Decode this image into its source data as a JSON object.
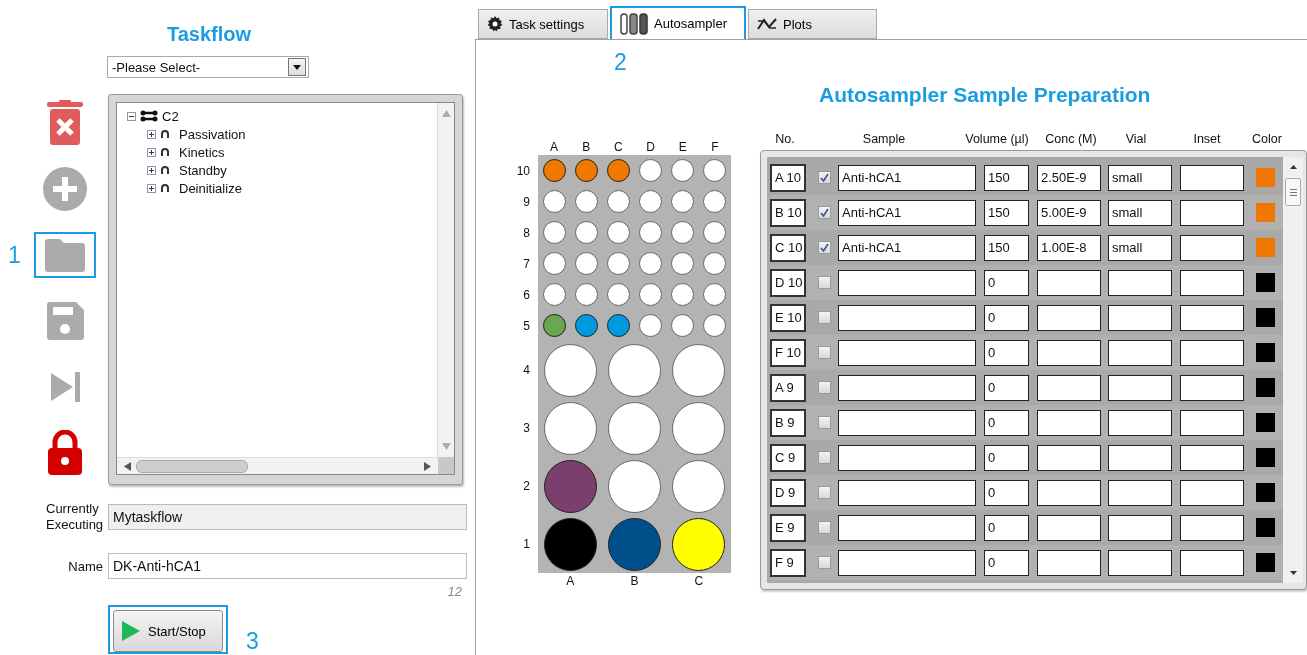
{
  "taskflow": {
    "title": "Taskflow",
    "select": {
      "value": "-Please Select-"
    },
    "tools": [
      {
        "kind": "delete"
      },
      {
        "kind": "add"
      },
      {
        "kind": "open",
        "callout": "1"
      },
      {
        "kind": "save"
      },
      {
        "kind": "skip"
      },
      {
        "kind": "lock"
      }
    ],
    "tree": {
      "label": "C2",
      "expanded": true,
      "children": [
        {
          "label": "Passivation",
          "expanded": false
        },
        {
          "label": "Kinetics",
          "expanded": false
        },
        {
          "label": "Standby",
          "expanded": false
        },
        {
          "label": "Deinitialize",
          "expanded": false
        }
      ]
    },
    "currently_executing": {
      "label": "Currently Executing",
      "value": "Mytaskflow"
    },
    "name": {
      "label": "Name",
      "value": "DK-Anti-hCA1",
      "counter": "12"
    },
    "start_button": {
      "label": "Start/Stop",
      "callout": "3"
    }
  },
  "tabs": [
    {
      "label": "Task settings",
      "kind": "settings",
      "selected": false
    },
    {
      "label": "Autosampler",
      "kind": "autosampler",
      "selected": true,
      "callout": "2"
    },
    {
      "label": "Plots",
      "kind": "plots",
      "selected": false
    }
  ],
  "autosampler": {
    "title": "Autosampler Sample Preparation",
    "plate": {
      "top_columns": [
        "A",
        "B",
        "C",
        "D",
        "E",
        "F"
      ],
      "small_rows": [
        {
          "label": "10",
          "wells": [
            {
              "color": "#f07800"
            },
            {
              "color": "#f07800"
            },
            {
              "color": "#f07800"
            },
            {
              "color": "#ffffff"
            },
            {
              "color": "#ffffff"
            },
            {
              "color": "#ffffff"
            }
          ]
        },
        {
          "label": "9",
          "wells": [
            {
              "color": "#ffffff"
            },
            {
              "color": "#ffffff"
            },
            {
              "color": "#ffffff"
            },
            {
              "color": "#ffffff"
            },
            {
              "color": "#ffffff"
            },
            {
              "color": "#ffffff"
            }
          ]
        },
        {
          "label": "8",
          "wells": [
            {
              "color": "#ffffff"
            },
            {
              "color": "#ffffff"
            },
            {
              "color": "#ffffff"
            },
            {
              "color": "#ffffff"
            },
            {
              "color": "#ffffff"
            },
            {
              "color": "#ffffff"
            }
          ]
        },
        {
          "label": "7",
          "wells": [
            {
              "color": "#ffffff"
            },
            {
              "color": "#ffffff"
            },
            {
              "color": "#ffffff"
            },
            {
              "color": "#ffffff"
            },
            {
              "color": "#ffffff"
            },
            {
              "color": "#ffffff"
            }
          ]
        },
        {
          "label": "6",
          "wells": [
            {
              "color": "#ffffff"
            },
            {
              "color": "#ffffff"
            },
            {
              "color": "#ffffff"
            },
            {
              "color": "#ffffff"
            },
            {
              "color": "#ffffff"
            },
            {
              "color": "#ffffff"
            }
          ]
        },
        {
          "label": "5",
          "wells": [
            {
              "color": "#6aa84f"
            },
            {
              "color": "#0099e0"
            },
            {
              "color": "#0099e0"
            },
            {
              "color": "#ffffff"
            },
            {
              "color": "#ffffff"
            },
            {
              "color": "#ffffff"
            }
          ]
        }
      ],
      "large_rows": [
        {
          "label": "4",
          "wells": [
            {
              "color": "#ffffff"
            },
            {
              "color": "#ffffff"
            },
            {
              "color": "#ffffff"
            }
          ]
        },
        {
          "label": "3",
          "wells": [
            {
              "color": "#ffffff"
            },
            {
              "color": "#ffffff"
            },
            {
              "color": "#ffffff"
            }
          ]
        },
        {
          "label": "2",
          "wells": [
            {
              "color": "#7b3f6e"
            },
            {
              "color": "#ffffff"
            },
            {
              "color": "#ffffff"
            }
          ]
        },
        {
          "label": "1",
          "wells": [
            {
              "color": "#000000"
            },
            {
              "color": "#004f8a"
            },
            {
              "color": "#ffff00"
            }
          ]
        }
      ],
      "bottom_columns": [
        "A",
        "B",
        "C"
      ]
    },
    "table": {
      "columns": [
        "No.",
        "Sample",
        "Volume (µl)",
        "Conc (M)",
        "Vial",
        "Inset",
        "Color"
      ],
      "rows": [
        {
          "no": "A 10",
          "checked": true,
          "sample": "Anti-hCA1",
          "volume": "150",
          "conc": "2.50E-9",
          "vial": "small",
          "color": "#f07800"
        },
        {
          "no": "B 10",
          "checked": true,
          "sample": "Anti-hCA1",
          "volume": "150",
          "conc": "5.00E-9",
          "vial": "small",
          "color": "#f07800"
        },
        {
          "no": "C 10",
          "checked": true,
          "sample": "Anti-hCA1",
          "volume": "150",
          "conc": "1.00E-8",
          "vial": "small",
          "color": "#f07800"
        },
        {
          "no": "D 10",
          "checked": false,
          "volume": "0",
          "color": "#000000"
        },
        {
          "no": "E 10",
          "checked": false,
          "volume": "0",
          "color": "#000000"
        },
        {
          "no": "F 10",
          "checked": false,
          "volume": "0",
          "color": "#000000"
        },
        {
          "no": "A 9",
          "checked": false,
          "volume": "0",
          "color": "#000000"
        },
        {
          "no": "B 9",
          "checked": false,
          "volume": "0",
          "color": "#000000"
        },
        {
          "no": "C 9",
          "checked": false,
          "volume": "0",
          "color": "#000000"
        },
        {
          "no": "D 9",
          "checked": false,
          "volume": "0",
          "color": "#000000"
        },
        {
          "no": "E 9",
          "checked": false,
          "volume": "0",
          "color": "#000000"
        },
        {
          "no": "F 9",
          "checked": false,
          "volume": "0",
          "color": "#000000"
        }
      ]
    }
  }
}
